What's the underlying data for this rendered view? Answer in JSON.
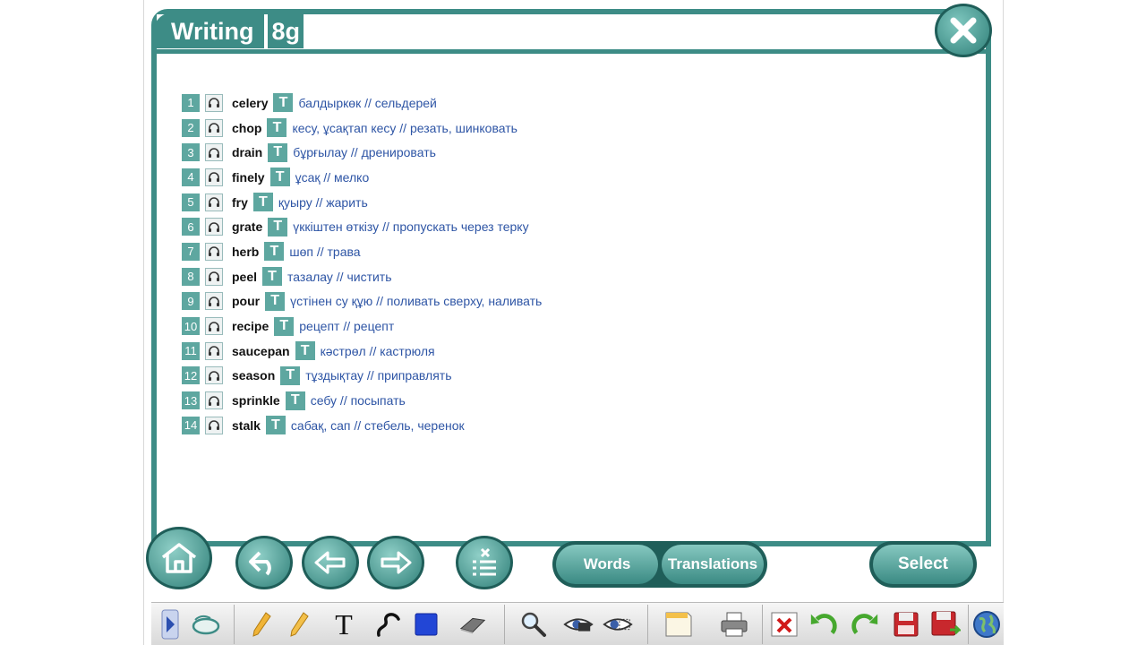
{
  "header": {
    "title": "Writing",
    "unit": "8g"
  },
  "words": [
    {
      "num": "1",
      "word": "celery",
      "translation": "балдыркөк // сельдерей"
    },
    {
      "num": "2",
      "word": "chop",
      "translation": "кесу, ұсақтап кесу // резать, шинковать"
    },
    {
      "num": "3",
      "word": "drain",
      "translation": "бұрғылау // дренировать"
    },
    {
      "num": "4",
      "word": "finely",
      "translation": "ұсақ // мелко"
    },
    {
      "num": "5",
      "word": "fry",
      "translation": "қуыру // жарить"
    },
    {
      "num": "6",
      "word": "grate",
      "translation": "үккіштен өткізу // пропускать через терку"
    },
    {
      "num": "7",
      "word": "herb",
      "translation": "шөп // трава"
    },
    {
      "num": "8",
      "word": "peel",
      "translation": "тазалау // чистить"
    },
    {
      "num": "9",
      "word": "pour",
      "translation": "үстінен су құю // поливать сверху, наливать"
    },
    {
      "num": "10",
      "word": "recipe",
      "translation": "рецепт // рецепт"
    },
    {
      "num": "11",
      "word": "saucepan",
      "translation": "кәстрөл // кастрюля"
    },
    {
      "num": "12",
      "word": "season",
      "translation": "тұздықтау // приправлять"
    },
    {
      "num": "13",
      "word": "sprinkle",
      "translation": "себу // посыпать"
    },
    {
      "num": "14",
      "word": "stalk",
      "translation": "сабақ, сап // стебель, черенок"
    }
  ],
  "t_label": "T",
  "buttons": {
    "words": "Words",
    "translations": "Translations",
    "select": "Select"
  },
  "icons": {
    "close": "close-icon",
    "home": "home-icon",
    "undo": "undo-arrow-icon",
    "back": "arrow-left-icon",
    "forward": "arrow-right-icon",
    "checklist": "checklist-icon",
    "headphones": "headphones-icon"
  },
  "colors": {
    "teal": "#3d8c86",
    "teal_light": "#5ea7a0",
    "translation_blue": "#2e55a5"
  }
}
